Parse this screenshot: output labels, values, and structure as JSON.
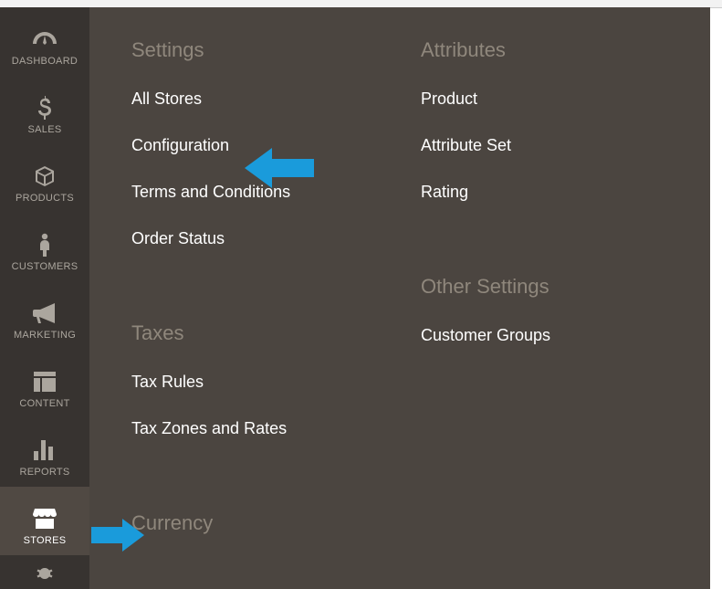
{
  "sidebar": {
    "items": [
      {
        "label": "DASHBOARD",
        "icon": "gauge"
      },
      {
        "label": "SALES",
        "icon": "dollar"
      },
      {
        "label": "PRODUCTS",
        "icon": "cube"
      },
      {
        "label": "CUSTOMERS",
        "icon": "person"
      },
      {
        "label": "MARKETING",
        "icon": "bullhorn"
      },
      {
        "label": "CONTENT",
        "icon": "layout"
      },
      {
        "label": "REPORTS",
        "icon": "bars"
      },
      {
        "label": "STORES",
        "icon": "storefront"
      }
    ],
    "active_index": 7
  },
  "flyout": {
    "columns": [
      {
        "sections": [
          {
            "heading": "Settings",
            "links": [
              "All Stores",
              "Configuration",
              "Terms and Conditions",
              "Order Status"
            ]
          },
          {
            "heading": "Taxes",
            "links": [
              "Tax Rules",
              "Tax Zones and Rates"
            ]
          },
          {
            "heading": "Currency",
            "links": []
          }
        ]
      },
      {
        "sections": [
          {
            "heading": "Attributes",
            "links": [
              "Product",
              "Attribute Set",
              "Rating"
            ]
          },
          {
            "heading": "Other Settings",
            "links": [
              "Customer Groups"
            ]
          }
        ]
      }
    ]
  },
  "annotations": {
    "arrow_color": "#1a9bdb"
  }
}
